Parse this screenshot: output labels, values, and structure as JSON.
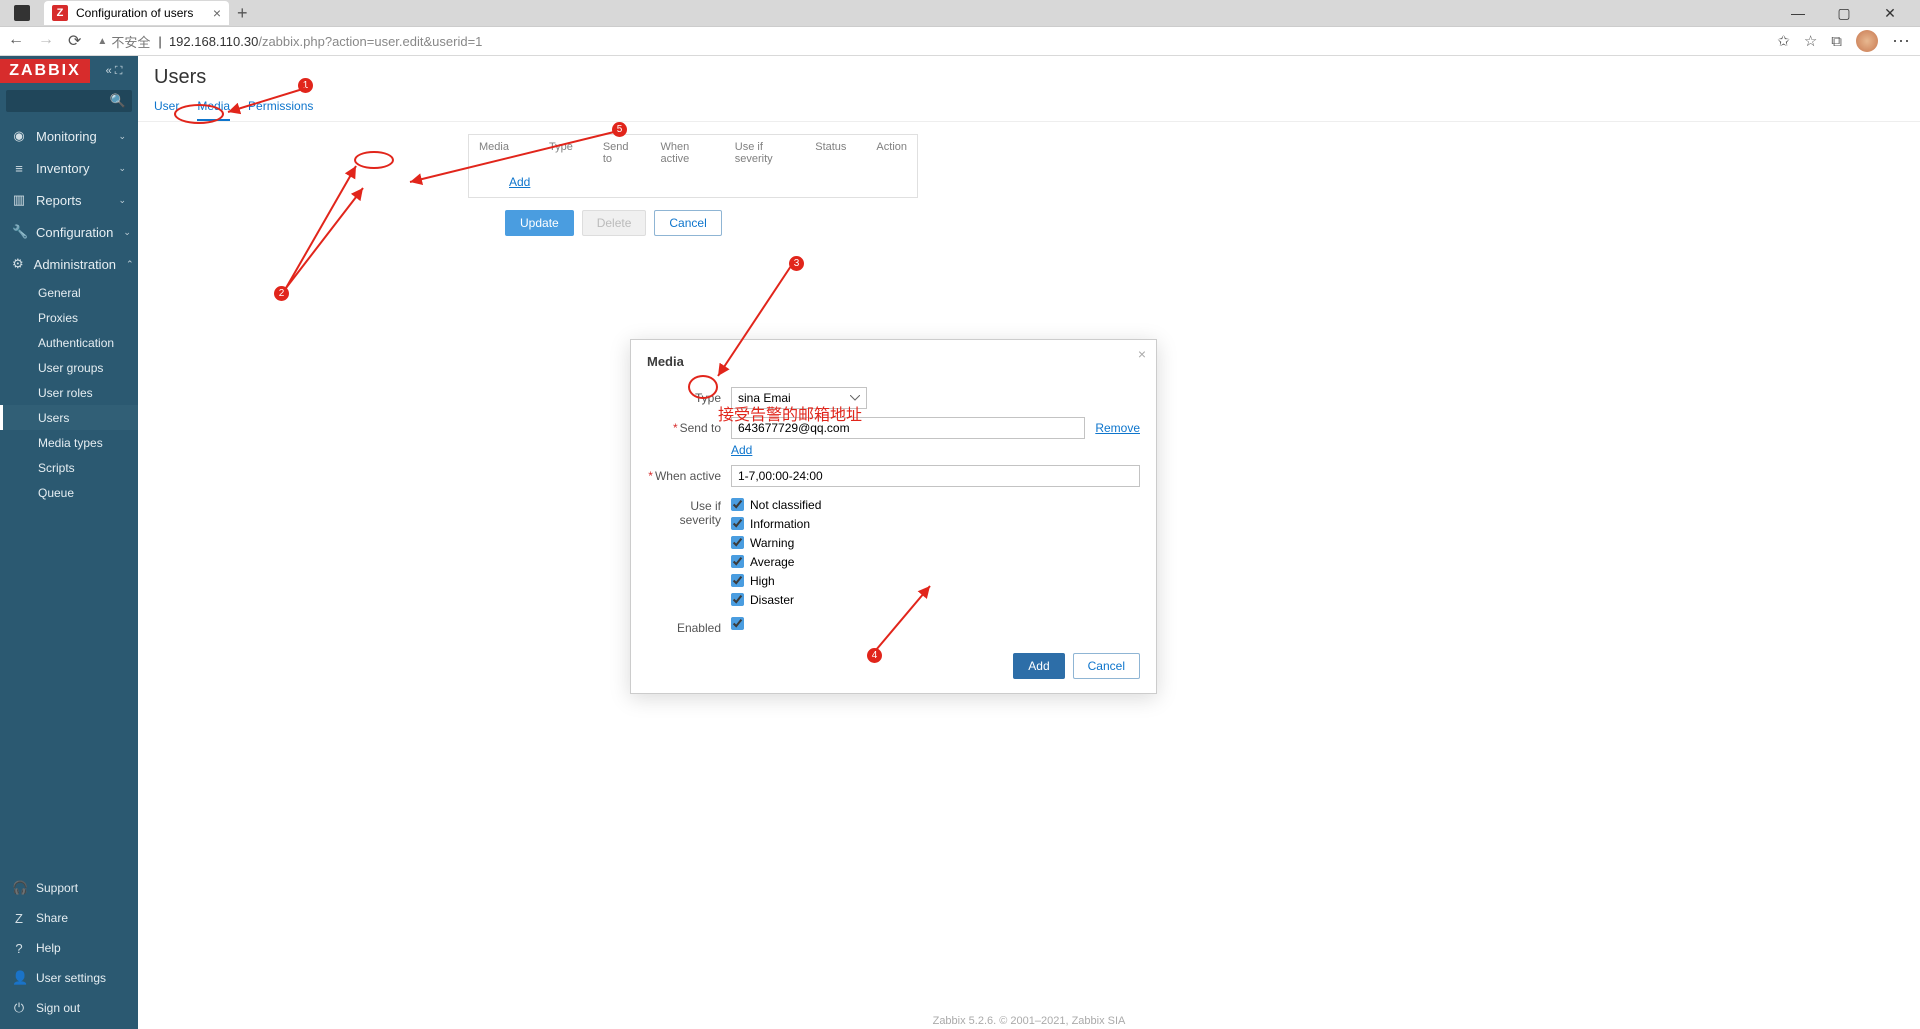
{
  "browser": {
    "tab_title": "Configuration of users",
    "url_warn": "不安全",
    "url_host": "192.168.110.30",
    "url_path": "/zabbix.php?action=user.edit&userid=1"
  },
  "sidebar": {
    "logo": "ZABBIX",
    "nav": [
      {
        "icon": "◉",
        "label": "Monitoring",
        "caret": true
      },
      {
        "icon": "≡",
        "label": "Inventory",
        "caret": true
      },
      {
        "icon": "▥",
        "label": "Reports",
        "caret": true
      },
      {
        "icon": "🔧",
        "label": "Configuration",
        "caret": true
      },
      {
        "icon": "⚙",
        "label": "Administration",
        "caret": true,
        "expanded": true
      }
    ],
    "admin_sub": [
      "General",
      "Proxies",
      "Authentication",
      "User groups",
      "User roles",
      "Users",
      "Media types",
      "Scripts",
      "Queue"
    ],
    "active_sub": "Users",
    "bottom": [
      {
        "icon": "🎧",
        "label": "Support"
      },
      {
        "icon": "Z",
        "label": "Share"
      },
      {
        "icon": "?",
        "label": "Help"
      },
      {
        "icon": "👤",
        "label": "User settings"
      },
      {
        "icon": "⏻",
        "label": "Sign out"
      }
    ]
  },
  "page": {
    "title": "Users",
    "tabs": [
      "User",
      "Media",
      "Permissions"
    ],
    "active_tab": "Media",
    "media_headers": [
      "Media",
      "Type",
      "Send to",
      "When active",
      "Use if severity",
      "Status",
      "Action"
    ],
    "add_link": "Add",
    "buttons": {
      "update": "Update",
      "delete": "Delete",
      "cancel": "Cancel"
    }
  },
  "modal": {
    "title": "Media",
    "labels": {
      "type": "Type",
      "send_to": "Send to",
      "when_active": "When active",
      "use_if_severity": "Use if severity",
      "enabled": "Enabled"
    },
    "type_value": "sina Emai",
    "send_to_value": "643677729@qq.com",
    "remove": "Remove",
    "add": "Add",
    "when_active_value": "1-7,00:00-24:00",
    "severities": [
      "Not classified",
      "Information",
      "Warning",
      "Average",
      "High",
      "Disaster"
    ],
    "enabled": true,
    "actions": {
      "add": "Add",
      "cancel": "Cancel"
    }
  },
  "annotations": {
    "text": "接受告警的邮箱地址",
    "nums": [
      "1",
      "2",
      "3",
      "4",
      "5"
    ]
  },
  "footer": "Zabbix 5.2.6. © 2001–2021, Zabbix SIA"
}
